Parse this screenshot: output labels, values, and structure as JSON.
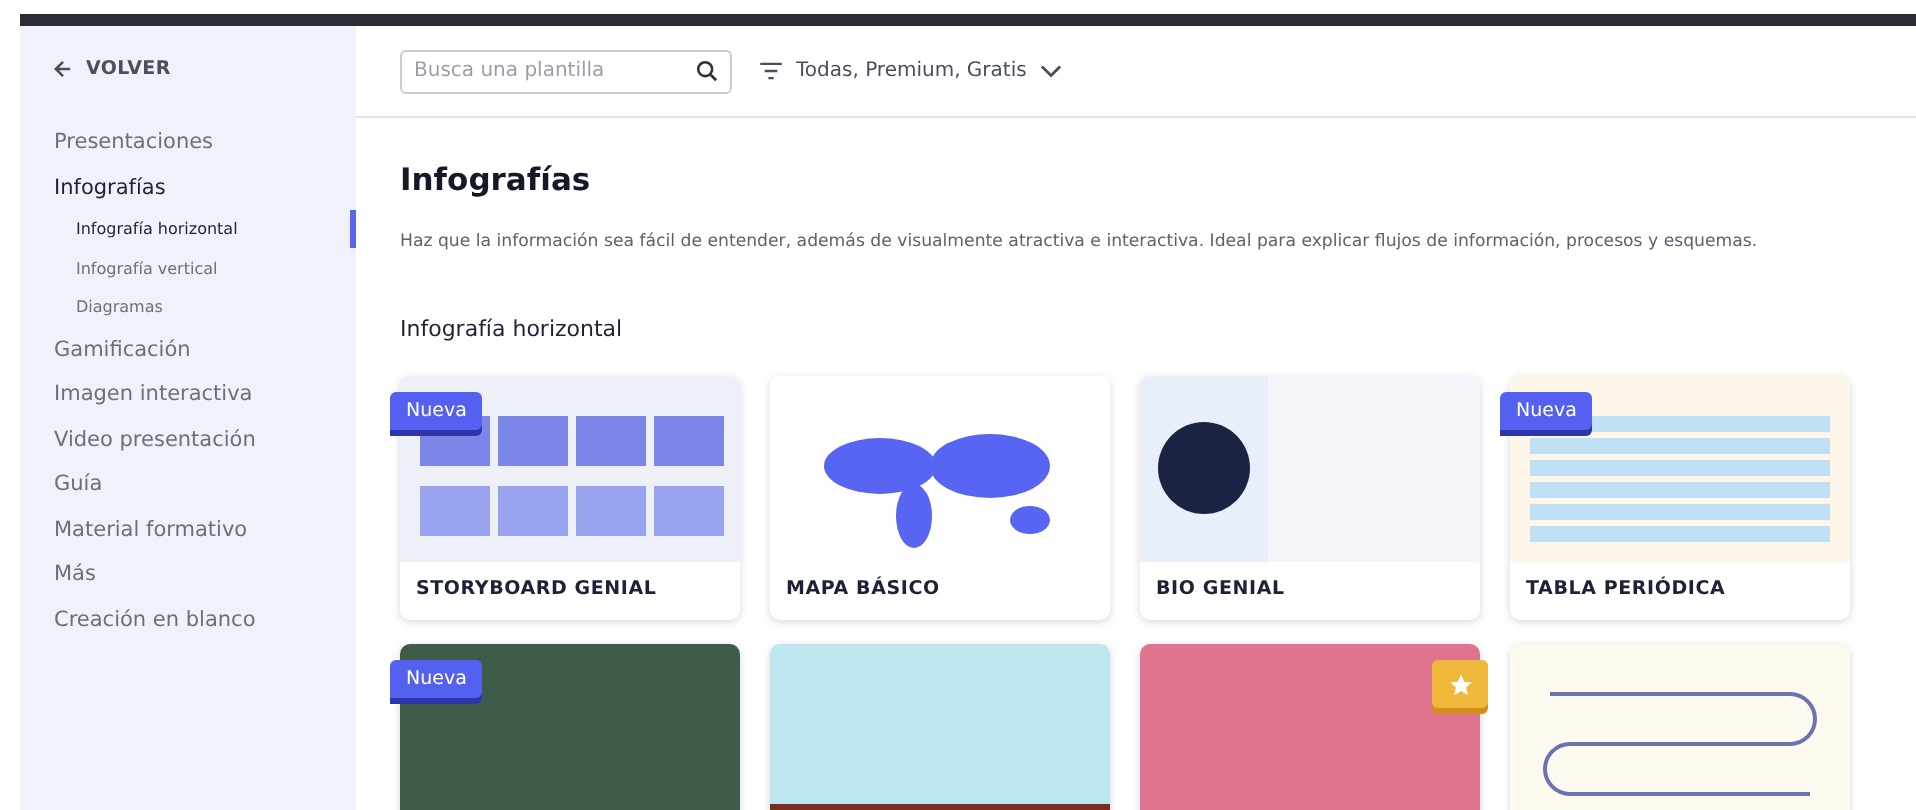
{
  "sidebar": {
    "back": "VOLVER",
    "items": [
      {
        "label": "Presentaciones",
        "selected": false
      },
      {
        "label": "Infografías",
        "selected": true,
        "children": [
          {
            "label": "Infografía horizontal",
            "selected": true
          },
          {
            "label": "Infografía vertical",
            "selected": false
          },
          {
            "label": "Diagramas",
            "selected": false
          }
        ]
      },
      {
        "label": "Gamificación",
        "selected": false
      },
      {
        "label": "Imagen interactiva",
        "selected": false
      },
      {
        "label": "Video presentación",
        "selected": false
      },
      {
        "label": "Guía",
        "selected": false
      },
      {
        "label": "Material formativo",
        "selected": false
      },
      {
        "label": "Más",
        "selected": false
      },
      {
        "label": "Creación en blanco",
        "selected": false
      }
    ]
  },
  "toolbar": {
    "search": {
      "placeholder": "Busca una plantilla"
    },
    "filter": "Todas, Premium, Gratis"
  },
  "page": {
    "title": "Infografías",
    "description": "Haz que la información sea fácil de entender, además de visualmente atractiva e interactiva. Ideal para explicar flujos de información, procesos y esquemas.",
    "section": "Infografía horizontal"
  },
  "cards": [
    {
      "kind": "storyboard",
      "title": "STORYBOARD GENIAL",
      "badge": {
        "kind": "new",
        "label": "Nueva"
      }
    },
    {
      "kind": "map",
      "title": "MAPA BÁSICO"
    },
    {
      "kind": "bio",
      "title": "BIO GENIAL"
    },
    {
      "kind": "table",
      "title": "TABLA PERIÓDICA",
      "badge": {
        "kind": "new",
        "label": "Nueva"
      }
    },
    {
      "kind": "chalkboard",
      "badge": {
        "kind": "new",
        "label": "Nueva"
      }
    },
    {
      "kind": "plants"
    },
    {
      "kind": "path",
      "badge": {
        "kind": "premium"
      }
    },
    {
      "kind": "timeline"
    }
  ]
}
